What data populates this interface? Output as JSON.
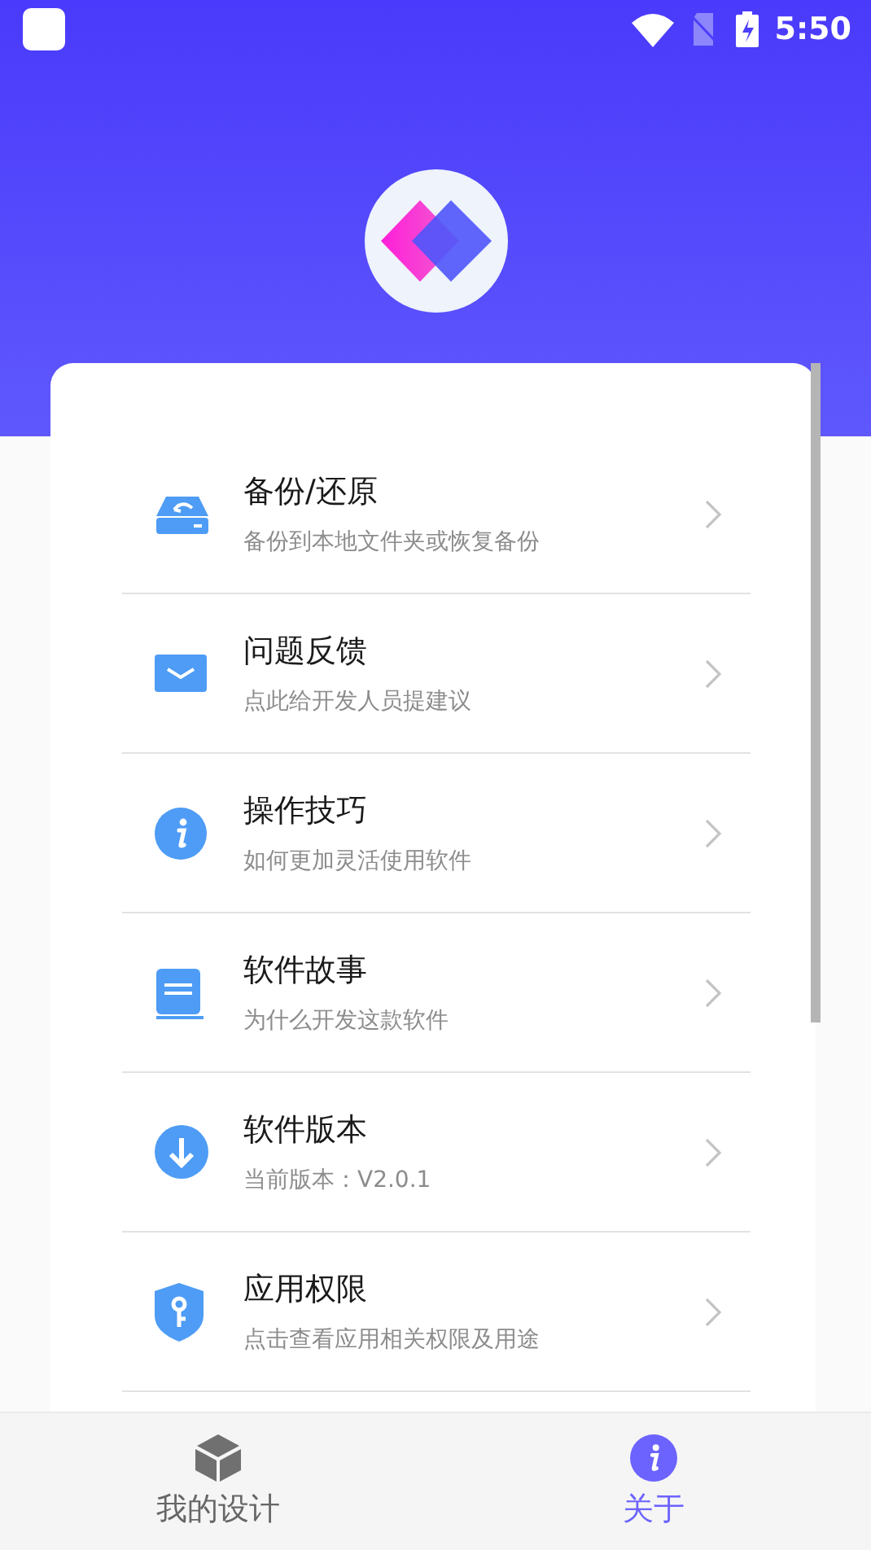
{
  "status_bar": {
    "time": "5:50"
  },
  "menu": [
    {
      "kind": "backup",
      "title": "备份/还原",
      "subtitle": "备份到本地文件夹或恢复备份"
    },
    {
      "kind": "feedback",
      "title": "问题反馈",
      "subtitle": "点此给开发人员提建议"
    },
    {
      "kind": "tips",
      "title": "操作技巧",
      "subtitle": "如何更加灵活使用软件"
    },
    {
      "kind": "story",
      "title": "软件故事",
      "subtitle": "为什么开发这款软件"
    },
    {
      "kind": "version",
      "title": "软件版本",
      "subtitle": "当前版本：V2.0.1"
    },
    {
      "kind": "permission",
      "title": "应用权限",
      "subtitle": "点击查看应用相关权限及用途"
    }
  ],
  "nav": [
    {
      "kind": "designs",
      "label": "我的设计",
      "selected": false
    },
    {
      "kind": "about",
      "label": "关于",
      "selected": true
    }
  ]
}
